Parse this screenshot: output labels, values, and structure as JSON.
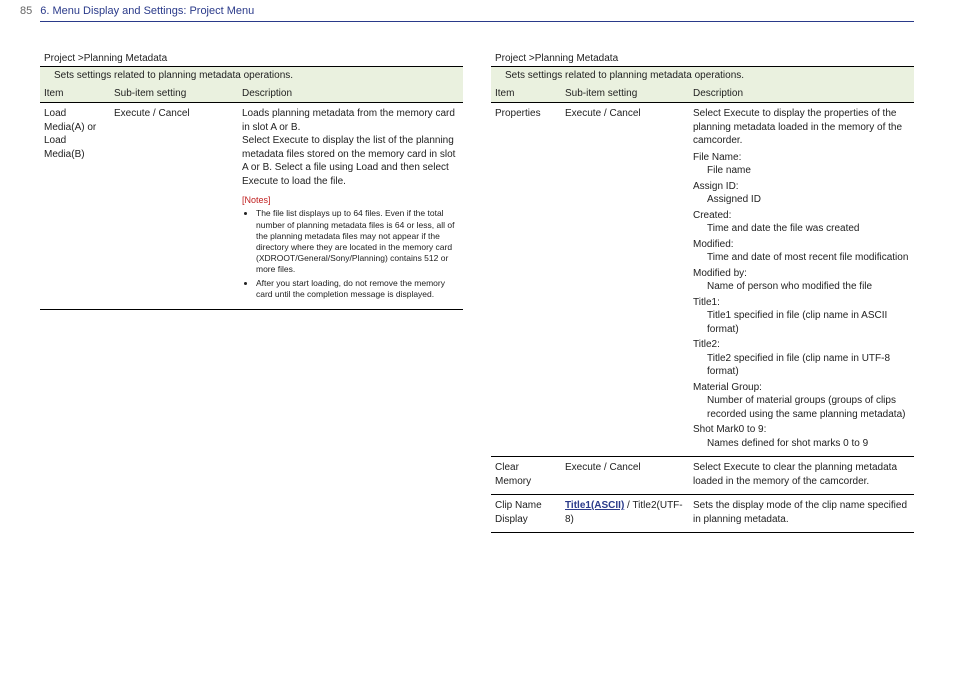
{
  "header": {
    "page_number": "85",
    "section_title": "6. Menu Display and Settings: Project Menu"
  },
  "left": {
    "panel_title": "Project >Planning Metadata",
    "panel_sub": "Sets settings related to planning metadata operations.",
    "columns": {
      "item": "Item",
      "sub": "Sub-item setting",
      "desc": "Description"
    },
    "row1": {
      "item": "Load Media(A) or Load Media(B)",
      "sub": "Execute / Cancel",
      "desc": "Loads planning metadata from the memory card in slot A or B.\nSelect Execute to display the list of the planning metadata files stored on the memory card in slot A or B. Select a file using Load and then select Execute to load the file.",
      "notes_label": "[Notes]",
      "notes": [
        "The file list displays up to 64 files. Even if the total number of planning metadata files is 64 or less, all of the planning metadata files may not appear if the directory where they are located in the memory card (XDROOT/General/Sony/Planning) contains 512 or more files.",
        "After you start loading, do not remove the memory card until the completion message is displayed."
      ]
    }
  },
  "right": {
    "panel_title": "Project >Planning Metadata",
    "panel_sub": "Sets settings related to planning metadata operations.",
    "columns": {
      "item": "Item",
      "sub": "Sub-item setting",
      "desc": "Description"
    },
    "row_props": {
      "item": "Properties",
      "sub": "Execute / Cancel",
      "desc_intro": "Select Execute to display the properties of the planning metadata loaded in the memory of the camcorder.",
      "defs": [
        {
          "term": "File Name:",
          "val": "File name"
        },
        {
          "term": "Assign ID:",
          "val": "Assigned ID"
        },
        {
          "term": "Created:",
          "val": "Time and date the file was created"
        },
        {
          "term": "Modified:",
          "val": "Time and date of most recent file modification"
        },
        {
          "term": "Modified by:",
          "val": "Name of person who modified the file"
        },
        {
          "term": "Title1:",
          "val": "Title1 specified in file (clip name in ASCII format)"
        },
        {
          "term": "Title2:",
          "val": "Title2 specified in file (clip name in UTF-8 format)"
        },
        {
          "term": "Material Group:",
          "val": "Number of material groups (groups of clips recorded using the same planning metadata)"
        },
        {
          "term": "Shot Mark0 to 9:",
          "val": "Names defined for shot marks 0 to 9"
        }
      ]
    },
    "row_clear": {
      "item": "Clear Memory",
      "sub": "Execute / Cancel",
      "desc": "Select Execute to clear the planning metadata loaded in the memory of the camcorder."
    },
    "row_clip": {
      "item": "Clip Name Display",
      "sub_selected": "Title1(ASCII)",
      "sub_sep": " / ",
      "sub_other": "Title2(UTF-8)",
      "desc": "Sets the display mode of the clip name specified in planning metadata."
    }
  }
}
